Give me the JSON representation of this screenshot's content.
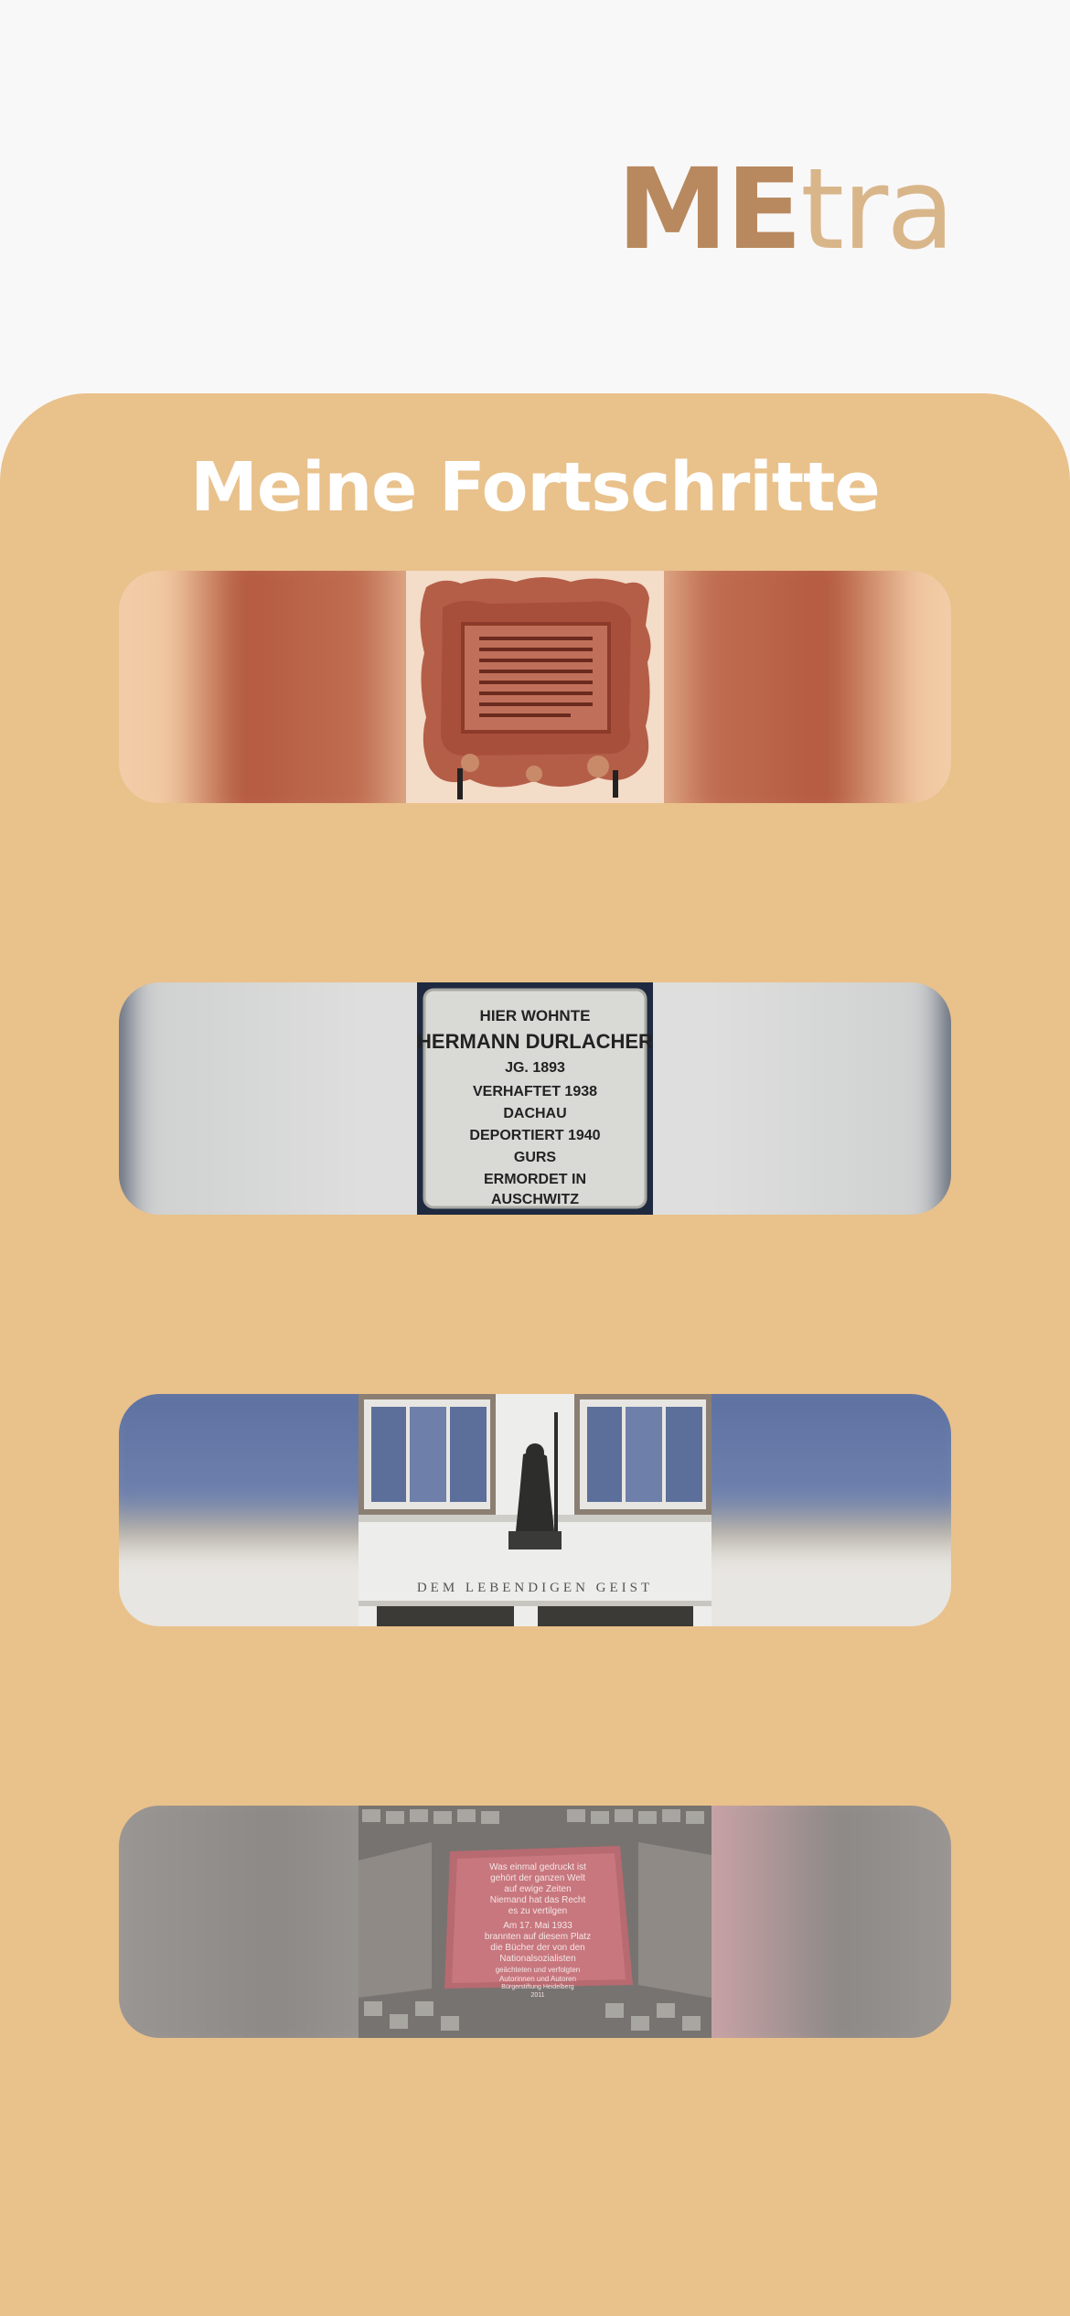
{
  "app": {
    "logo_part1": "ME",
    "logo_part2": "tra",
    "brand_color": "#b8895e",
    "brand_color_light": "#d9b68a"
  },
  "panel": {
    "title": "Meine Fortschritte",
    "background": "#e9c18b"
  },
  "cards": [
    {
      "image": "red-sandstone-memorial-plaque"
    },
    {
      "image": "stolperstein",
      "inscription": [
        "HIER WOHNTE",
        "HERMANN DURLACHER",
        "JG. 1893",
        "VERHAFTET 1938",
        "DACHAU",
        "DEPORTIERT 1940",
        "GURS",
        "ERMORDET IN",
        "AUSCHWITZ"
      ]
    },
    {
      "image": "university-facade-statue",
      "inscription": "DEM LEBENDIGEN GEIST"
    },
    {
      "image": "book-burning-memorial-plaque",
      "inscription": [
        "Was einmal gedruckt ist",
        "gehört der ganzen Welt",
        "auf ewige Zeiten",
        "Niemand hat das Recht",
        "es zu vertilgen",
        "Am 17. Mai 1933",
        "brannten auf diesem Platz",
        "die Bücher der von den",
        "Nationalsozialisten",
        "geächteten und verfolgten",
        "Autorinnen und Autoren",
        "Bürgerstiftung Heidelberg",
        "2011"
      ]
    }
  ]
}
